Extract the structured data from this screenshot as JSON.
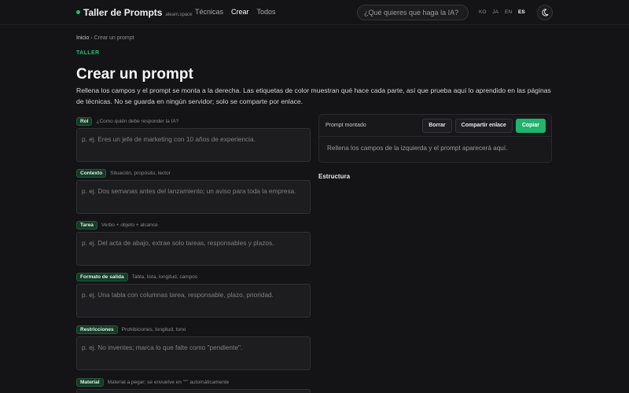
{
  "header": {
    "brand": "Taller de Prompts",
    "domain": "aleam.space",
    "nav": [
      "Técnicas",
      "Crear",
      "Todos"
    ],
    "nav_active": "Crear",
    "search_placeholder": "¿Qué quieres que haga la IA?",
    "languages": [
      "KO",
      "JA",
      "EN",
      "ES"
    ],
    "language_active": "ES"
  },
  "breadcrumb": {
    "home": "Inicio",
    "separator": "›",
    "current": "Crear un prompt"
  },
  "eyebrow": "TALLER",
  "title": "Crear un prompt",
  "intro": "Rellena los campos y el prompt se monta a la derecha. Las etiquetas de color muestran qué hace cada parte, así que prueba aquí lo aprendido en las páginas de técnicas. No se guarda en ningún servidor; solo se comparte por enlace.",
  "fields": [
    {
      "label": "Rol",
      "hint": "¿Como quién debe responder la IA?",
      "placeholder": "p. ej. Eres un jefe de marketing con 10 años de experiencia."
    },
    {
      "label": "Contexto",
      "hint": "Situación, propósito, lector",
      "placeholder": "p. ej. Dos semanas antes del lanzamiento; un aviso para toda la empresa."
    },
    {
      "label": "Tarea",
      "hint": "Verbo + objeto + alcance",
      "placeholder": "p. ej. Del acta de abajo, extrae solo tareas, responsables y plazos."
    },
    {
      "label": "Formato de salida",
      "hint": "Tabla, lista, longitud, campos",
      "placeholder": "p. ej. Una tabla con columnas tarea, responsable, plazo, prioridad."
    },
    {
      "label": "Restricciones",
      "hint": "Prohibiciones, longitud, tono",
      "placeholder": "p. ej. No inventes; marca lo que falte como \"pendiente\"."
    },
    {
      "label": "Material",
      "hint": "Material a pegar; se envuelve en \"\"\" automáticamente",
      "placeholder": ""
    }
  ],
  "output": {
    "title": "Prompt montado",
    "clear": "Borrar",
    "share": "Compartir enlace",
    "copy": "Copiar",
    "empty": "Rellena los campos de la izquierda y el prompt aparecerá aquí."
  },
  "structure_title": "Estructura",
  "colors": {
    "accent": "#22c07a",
    "background": "#141416",
    "tag_bg": "#173a28"
  }
}
